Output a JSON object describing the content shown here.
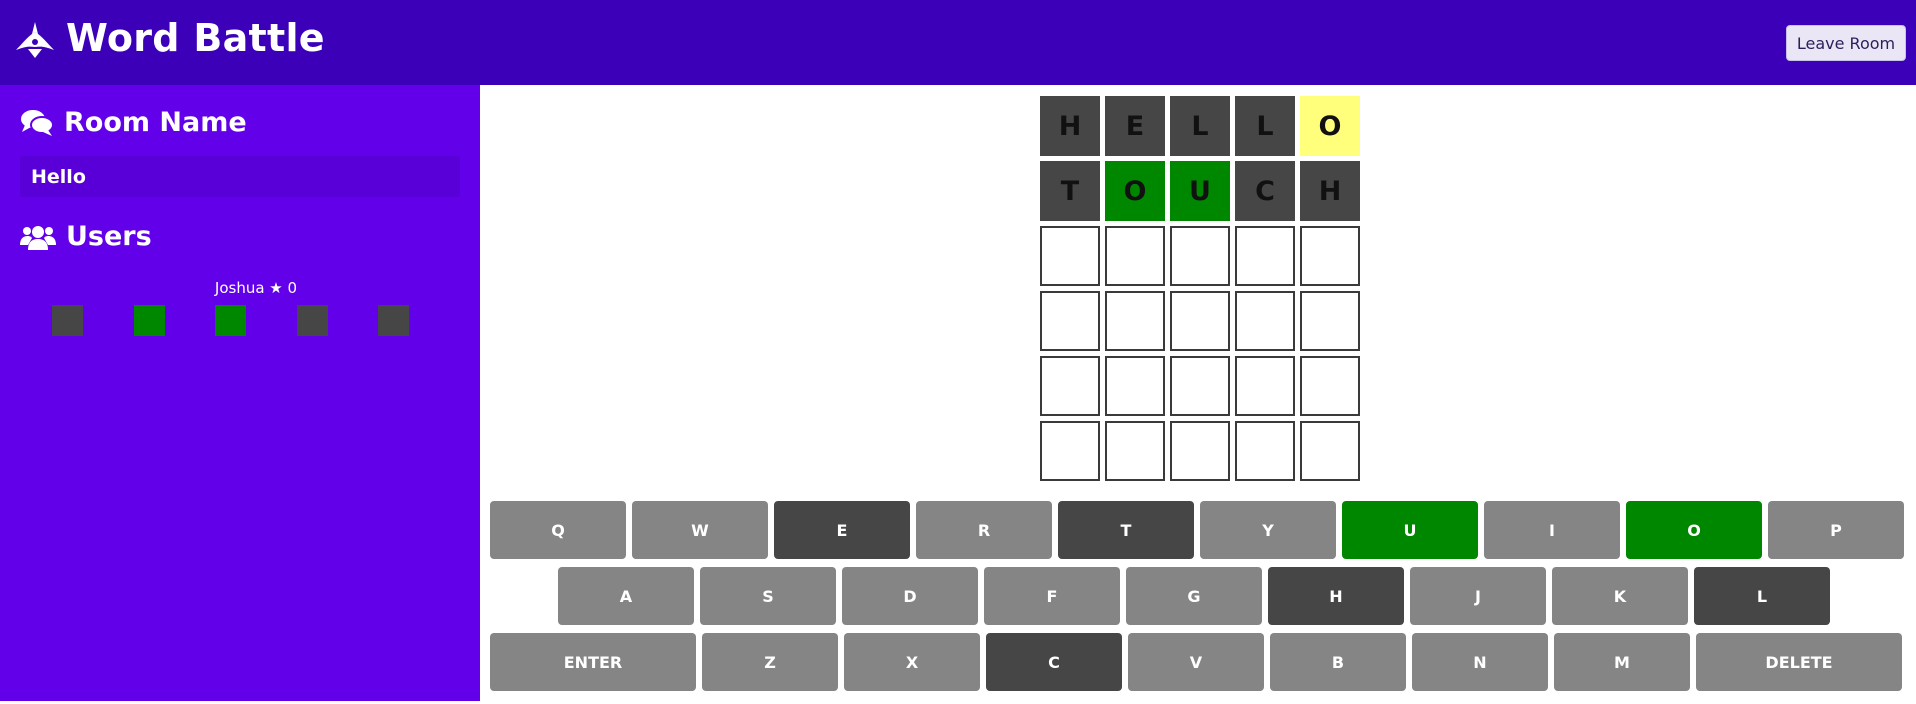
{
  "app": {
    "title": "Word Battle",
    "leave_label": "Leave Room"
  },
  "colors": {
    "header_bg": "#3c00b9",
    "sidebar_bg": "#6200ea",
    "absent": "#464646",
    "present": "#ffff7c",
    "correct": "#008700",
    "unused_key": "#858585"
  },
  "sidebar": {
    "room_heading": "Room Name",
    "room_value": "Hello",
    "users_heading": "Users",
    "users": [
      {
        "label": "Joshua ★ 0",
        "results": [
          "absent",
          "correct",
          "correct",
          "absent",
          "absent"
        ]
      }
    ]
  },
  "board": {
    "rows": [
      [
        {
          "letter": "H",
          "state": "absent"
        },
        {
          "letter": "E",
          "state": "absent"
        },
        {
          "letter": "L",
          "state": "absent"
        },
        {
          "letter": "L",
          "state": "absent"
        },
        {
          "letter": "O",
          "state": "present"
        }
      ],
      [
        {
          "letter": "T",
          "state": "absent"
        },
        {
          "letter": "O",
          "state": "correct"
        },
        {
          "letter": "U",
          "state": "correct"
        },
        {
          "letter": "C",
          "state": "absent"
        },
        {
          "letter": "H",
          "state": "absent"
        }
      ],
      [
        {
          "letter": "",
          "state": "empty"
        },
        {
          "letter": "",
          "state": "empty"
        },
        {
          "letter": "",
          "state": "empty"
        },
        {
          "letter": "",
          "state": "empty"
        },
        {
          "letter": "",
          "state": "empty"
        }
      ],
      [
        {
          "letter": "",
          "state": "empty"
        },
        {
          "letter": "",
          "state": "empty"
        },
        {
          "letter": "",
          "state": "empty"
        },
        {
          "letter": "",
          "state": "empty"
        },
        {
          "letter": "",
          "state": "empty"
        }
      ],
      [
        {
          "letter": "",
          "state": "empty"
        },
        {
          "letter": "",
          "state": "empty"
        },
        {
          "letter": "",
          "state": "empty"
        },
        {
          "letter": "",
          "state": "empty"
        },
        {
          "letter": "",
          "state": "empty"
        }
      ],
      [
        {
          "letter": "",
          "state": "empty"
        },
        {
          "letter": "",
          "state": "empty"
        },
        {
          "letter": "",
          "state": "empty"
        },
        {
          "letter": "",
          "state": "empty"
        },
        {
          "letter": "",
          "state": "empty"
        }
      ]
    ]
  },
  "keyboard": {
    "rows": [
      [
        {
          "label": "Q",
          "state": "unused"
        },
        {
          "label": "W",
          "state": "unused"
        },
        {
          "label": "E",
          "state": "absent"
        },
        {
          "label": "R",
          "state": "unused"
        },
        {
          "label": "T",
          "state": "absent"
        },
        {
          "label": "Y",
          "state": "unused"
        },
        {
          "label": "U",
          "state": "correct"
        },
        {
          "label": "I",
          "state": "unused"
        },
        {
          "label": "O",
          "state": "correct"
        },
        {
          "label": "P",
          "state": "unused"
        }
      ],
      [
        {
          "label": "A",
          "state": "unused"
        },
        {
          "label": "S",
          "state": "unused"
        },
        {
          "label": "D",
          "state": "unused"
        },
        {
          "label": "F",
          "state": "unused"
        },
        {
          "label": "G",
          "state": "unused"
        },
        {
          "label": "H",
          "state": "absent"
        },
        {
          "label": "J",
          "state": "unused"
        },
        {
          "label": "K",
          "state": "unused"
        },
        {
          "label": "L",
          "state": "absent"
        }
      ],
      [
        {
          "label": "ENTER",
          "state": "unused",
          "wide": true
        },
        {
          "label": "Z",
          "state": "unused"
        },
        {
          "label": "X",
          "state": "unused"
        },
        {
          "label": "C",
          "state": "absent"
        },
        {
          "label": "V",
          "state": "unused"
        },
        {
          "label": "B",
          "state": "unused"
        },
        {
          "label": "N",
          "state": "unused"
        },
        {
          "label": "M",
          "state": "unused"
        },
        {
          "label": "DELETE",
          "state": "unused",
          "wide": true
        }
      ]
    ]
  }
}
